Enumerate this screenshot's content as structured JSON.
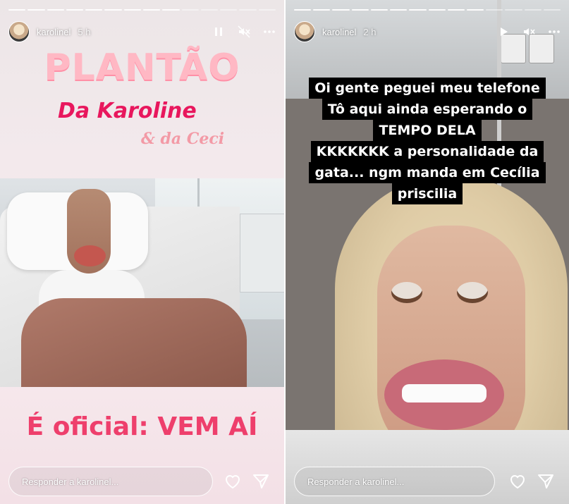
{
  "left_story": {
    "progress": {
      "total_segments": 14,
      "completed_segments": 9
    },
    "username": "karolinel",
    "time": "5 h",
    "icons": {
      "pause": "pause-icon",
      "mute": "muted-icon",
      "more": "more-icon"
    },
    "title_line1": "PLANTÃO",
    "title_line2": "Da Karoline",
    "title_line3": "& da Ceci",
    "footer": "É oficial: VEM AÍ",
    "reply_placeholder": "Responder a karolinel...",
    "colors": {
      "title_pink": "#ffb8c4",
      "accent_pink": "#e8175d",
      "footer_pink": "#ee3f6c"
    }
  },
  "right_story": {
    "progress": {
      "total_segments": 14,
      "completed_segments": 10
    },
    "username": "karolinel",
    "time": "2 h",
    "icons": {
      "play": "play-icon",
      "mute": "muted-icon",
      "more": "more-icon"
    },
    "caption_lines": [
      "Oi gente peguei meu telefone",
      "Tô aqui ainda esperando o",
      "TEMPO DELA",
      "KKKKKKK a personalidade da",
      "gata... ngm manda em Cecília",
      "priscilia"
    ],
    "reply_placeholder": "Responder a karolinel..."
  },
  "actions": {
    "like": "heart-icon",
    "share": "send-icon"
  }
}
